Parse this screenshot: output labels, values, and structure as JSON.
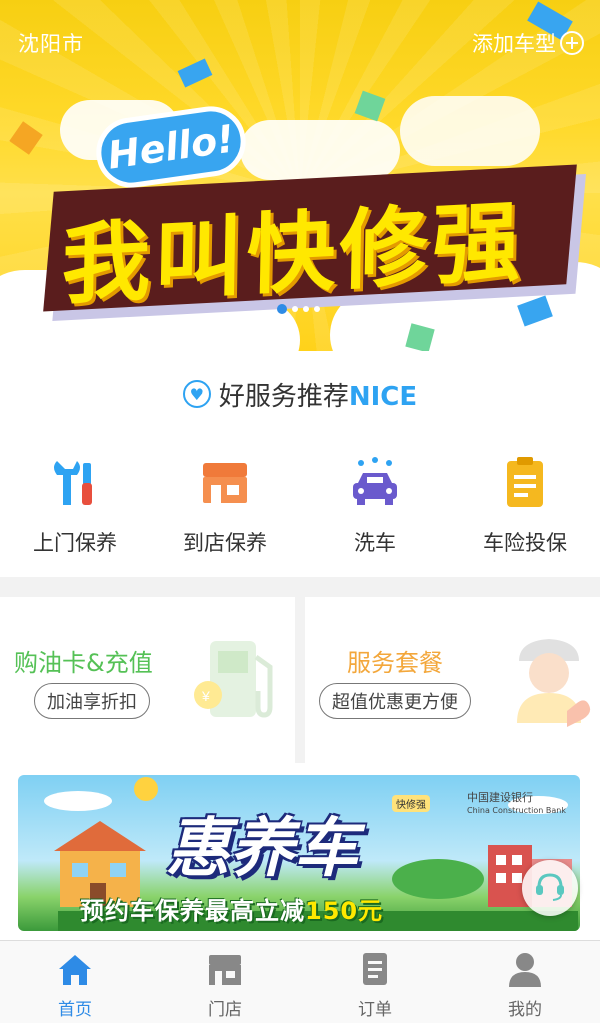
{
  "header": {
    "city": "沈阳市",
    "add_car_label": "添加车型"
  },
  "hero": {
    "hello": "Hello!",
    "slogan": "我叫快修强",
    "slides": 4,
    "active_slide": 0
  },
  "recommend": {
    "prefix": "好服务推荐",
    "suffix": "NICE"
  },
  "services": [
    {
      "label": "上门保养",
      "icon": "tools-icon"
    },
    {
      "label": "到店保养",
      "icon": "store-icon"
    },
    {
      "label": "洗车",
      "icon": "car-wash-icon"
    },
    {
      "label": "车险投保",
      "icon": "clipboard-icon"
    }
  ],
  "cards": [
    {
      "title": "购油卡&充值",
      "pill": "加油享折扣",
      "title_color": "#55c156",
      "icon": "fuel-pump-icon"
    },
    {
      "title": "服务套餐",
      "pill": "超值优惠更方便",
      "title_color": "#f3a73b",
      "icon": "mechanic-icon"
    }
  ],
  "promo": {
    "headline": "惠养车",
    "sub_prefix": "预约车保养最高立减",
    "sub_amount": "150元",
    "bank_cn": "中国建设银行",
    "bank_en": "China Construction Bank",
    "brand": "快修强"
  },
  "tabs": [
    {
      "label": "首页",
      "icon": "home-icon",
      "active": true
    },
    {
      "label": "门店",
      "icon": "store-icon",
      "active": false
    },
    {
      "label": "订单",
      "icon": "order-icon",
      "active": false
    },
    {
      "label": "我的",
      "icon": "user-icon",
      "active": false
    }
  ],
  "colors": {
    "accent": "#2e8be6",
    "nice_blue": "#2ea3f2",
    "hero_yellow": "#ffd92a"
  }
}
